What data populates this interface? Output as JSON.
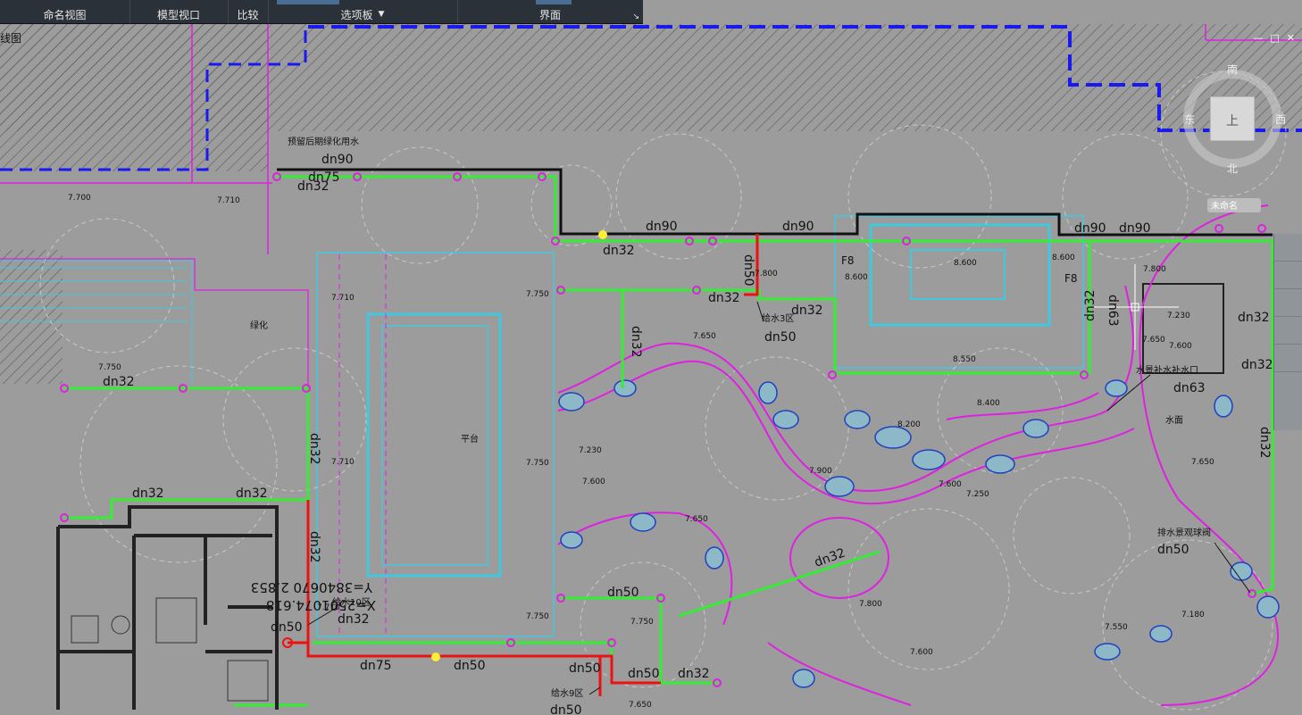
{
  "ribbon": {
    "groups": [
      {
        "label": "命名视图"
      },
      {
        "label": "模型视口"
      },
      {
        "label": "比较"
      },
      {
        "label": "选项板",
        "dropdown": "▼"
      },
      {
        "label": "界面",
        "dropdown": "↘"
      }
    ]
  },
  "viewport": {
    "label": "线图",
    "controls": [
      "—",
      "□",
      "✕"
    ],
    "viewcube": {
      "top_label": "南",
      "left_label": "东",
      "right_label": "西",
      "bottom_label": "北",
      "face": "上",
      "ucs": "未命名"
    }
  },
  "pipe_labels": [
    "dn90",
    "dn75",
    "dn32",
    "dn32",
    "dn90",
    "dn90",
    "dn90",
    "dn90",
    "dn32",
    "dn50",
    "dn32",
    "dn32",
    "dn50",
    "dn32",
    "dn63",
    "dn32",
    "dn32",
    "dn50",
    "dn63",
    "dn32",
    "dn32",
    "dn32",
    "dn32",
    "dn32",
    "dn50",
    "dn50",
    "dn32",
    "dn50",
    "dn50",
    "dn75",
    "dn50",
    "dn50",
    "dn50",
    "dn32",
    "dn32",
    "dn32",
    "dn50"
  ],
  "annotations": {
    "reserve_water": "预留后期绿化用水",
    "zone3": "给水3区",
    "zone10": "给水10区",
    "zone9": "给水9区",
    "landscape_inlet": "水景补水补水口",
    "drain_valve": "排水景观球阀",
    "coord_x": "X=2501074.618",
    "coord_y": "Y=3840670 2.853",
    "platform": "平台",
    "green1": "绿化",
    "water": "水面",
    "f18a": "F8",
    "f18b": "F8"
  },
  "elevations": [
    "7.700",
    "7.710",
    "7.750",
    "7.710",
    "7.750",
    "7.710",
    "7.750",
    "7.800",
    "8.600",
    "8.600",
    "8.600",
    "8.550",
    "7.800",
    "7.230",
    "7.650",
    "7.600",
    "7.650",
    "7.900",
    "8.200",
    "8.400",
    "7.600",
    "7.250",
    "7.650",
    "7.650",
    "7.800",
    "7.180",
    "7.550",
    "7.600",
    "7.750",
    "7.750",
    "7.650",
    "7.230",
    "7.600",
    "7.710"
  ],
  "colors": {
    "bg": "#9c9c9c",
    "green": "#33ee33",
    "red": "#ee1111",
    "magenta": "#e020e0",
    "blue": "#1a1aee",
    "cyan": "#40c8e0"
  }
}
